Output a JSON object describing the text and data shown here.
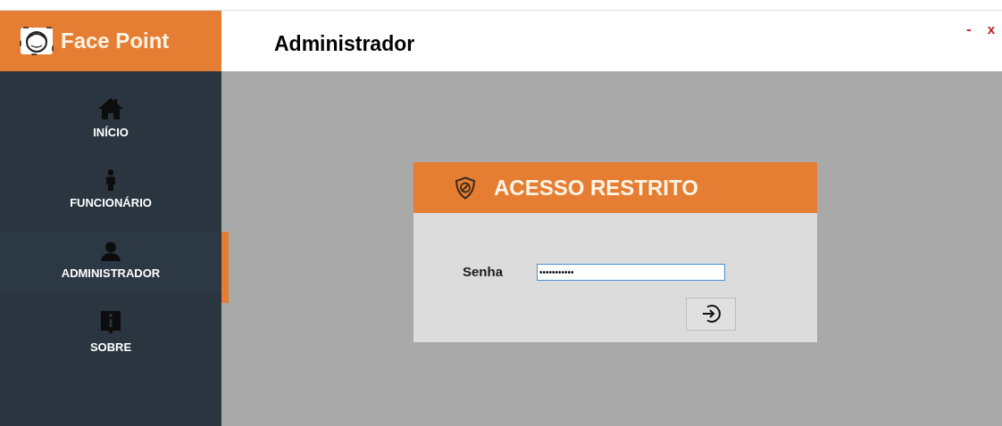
{
  "app": {
    "name": "Face Point"
  },
  "header": {
    "title": "Administrador",
    "window_controls": [
      {
        "kind": "minimize",
        "label": "-"
      },
      {
        "kind": "close",
        "label": "x"
      }
    ]
  },
  "sidebar": {
    "items": [
      {
        "kind": "home",
        "label": "INÍCIO",
        "selected": false
      },
      {
        "kind": "employee",
        "label": "FUNCIONÁRIO",
        "selected": false
      },
      {
        "kind": "admin",
        "label": "ADMINISTRADOR",
        "selected": true
      },
      {
        "kind": "about",
        "label": "SOBRE",
        "selected": false
      }
    ]
  },
  "dialog": {
    "title": "ACESSO RESTRITO",
    "field": {
      "label": "Senha",
      "value": "•••••••••••"
    }
  }
}
